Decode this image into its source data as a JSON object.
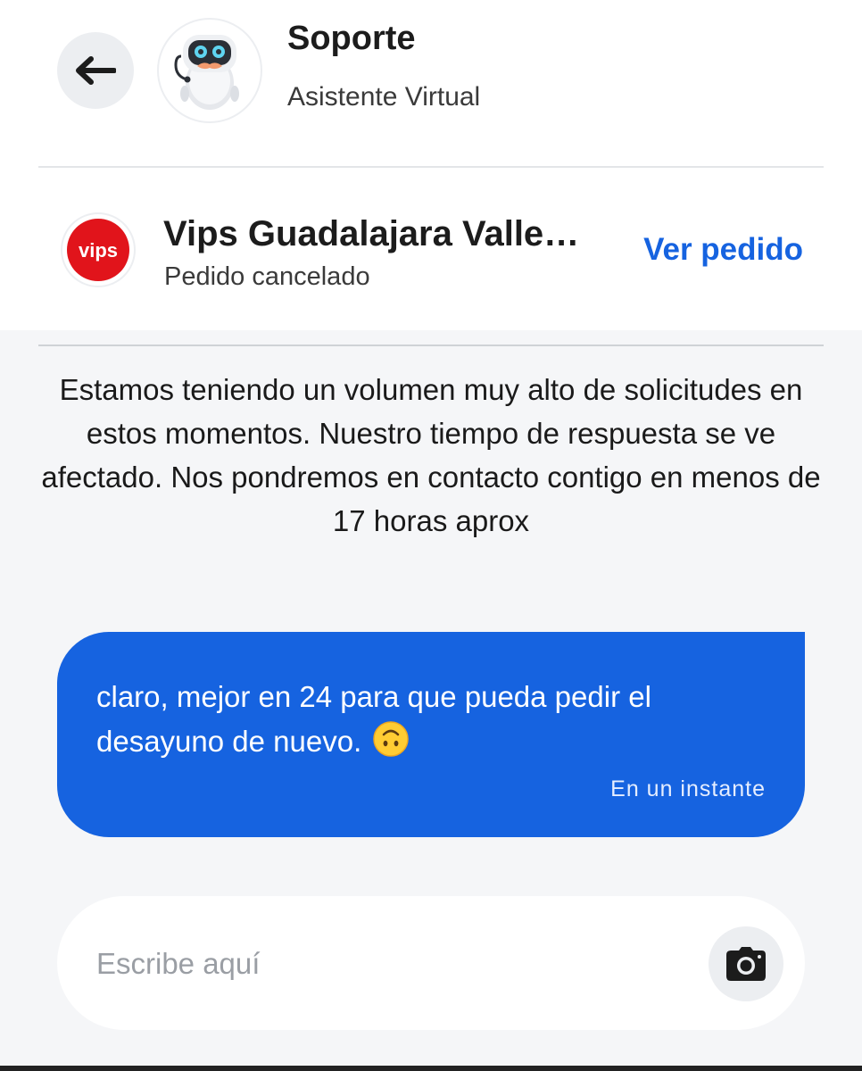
{
  "header": {
    "title": "Soporte",
    "subtitle": "Asistente Virtual",
    "back_icon": "arrow-left-icon",
    "avatar_icon": "robot-assistant-icon"
  },
  "order": {
    "store_logo_text": "vips",
    "store_name": "Vips Guadalajara Valle Real",
    "status": "Pedido cancelado",
    "view_order_label": "Ver pedido"
  },
  "chat": {
    "system_message": "Estamos teniendo un volumen muy alto de solicitudes en estos momentos. Nuestro tiempo de respuesta se ve afectado. Nos pondremos en contacto contigo en menos de 17 horas aprox",
    "messages": [
      {
        "text": "claro, mejor en 24 para que pueda pedir el desayuno de nuevo.",
        "emoji": "upside-down-face",
        "time": "En un instante"
      }
    ]
  },
  "composer": {
    "placeholder": "Escribe aquí",
    "value": "",
    "camera_icon": "camera-icon"
  },
  "colors": {
    "accent": "#1663e0",
    "brand_red": "#e1141b",
    "background": "#f5f6f8"
  }
}
